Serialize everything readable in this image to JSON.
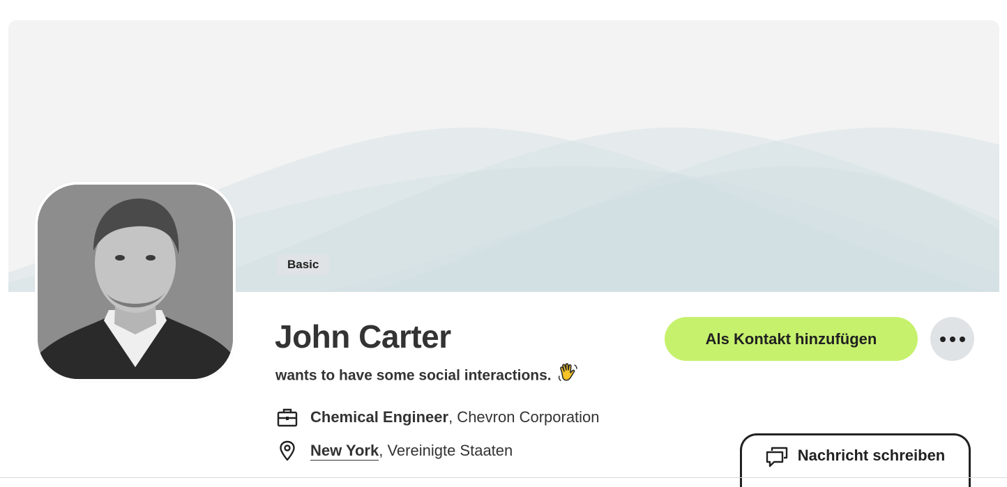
{
  "profile": {
    "membership_badge": "Basic",
    "name": "John Carter",
    "tagline": "wants to have some social interactions.",
    "job_title": "Chemical Engineer",
    "company_suffix": ", Chevron Corporation",
    "city": "New York",
    "country_suffix": ", Vereinigte Staaten"
  },
  "actions": {
    "add_contact_label": "Als Kontakt hinzufügen",
    "message_label": "Nachricht schreiben"
  },
  "icons": {
    "more": "more-horizontal-icon",
    "briefcase": "briefcase-icon",
    "location": "location-pin-icon",
    "message": "chat-bubbles-icon",
    "wave": "waving-hand-emoji"
  },
  "colors": {
    "accent": "#c6f16d",
    "cover_bg": "#f3f3f3",
    "wave_fill": "#cfe0e2",
    "badge_bg": "#dfe3e6"
  }
}
